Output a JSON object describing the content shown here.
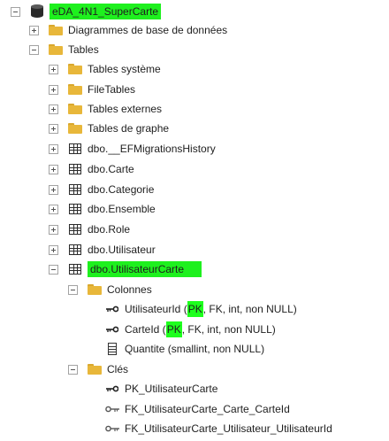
{
  "tree": {
    "root": {
      "label": "eDA_4N1_SuperCarte"
    },
    "diagrams": {
      "label": "Diagrammes de base de données"
    },
    "tables_folder": {
      "label": "Tables"
    },
    "tables_system": {
      "label": "Tables système"
    },
    "filetables": {
      "label": "FileTables"
    },
    "tables_external": {
      "label": "Tables externes"
    },
    "tables_graph": {
      "label": "Tables de graphe"
    },
    "tables": [
      {
        "label": "dbo.__EFMigrationsHistory"
      },
      {
        "label": "dbo.Carte"
      },
      {
        "label": "dbo.Categorie"
      },
      {
        "label": "dbo.Ensemble"
      },
      {
        "label": "dbo.Role"
      },
      {
        "label": "dbo.Utilisateur"
      },
      {
        "label": "dbo.UtilisateurCarte"
      }
    ],
    "columns_folder": {
      "label": "Colonnes"
    },
    "columns": [
      {
        "name": "UtilisateurId (",
        "pk": "PK",
        "rest": ", FK, int, non NULL)"
      },
      {
        "name": "CarteId (",
        "pk": "PK",
        "rest": ", FK, int, non NULL)"
      },
      {
        "name": "Quantite (smallint, non NULL)"
      }
    ],
    "keys_folder": {
      "label": "Clés"
    },
    "keys": [
      {
        "label": "PK_UtilisateurCarte"
      },
      {
        "label": "FK_UtilisateurCarte_Carte_CarteId"
      },
      {
        "label": "FK_UtilisateurCarte_Utilisateur_UtilisateurId"
      }
    ]
  },
  "colors": {
    "highlight": "#1dff1d",
    "folder": "#e8b73a"
  },
  "icons": {
    "database": "database-icon",
    "folder": "folder-icon",
    "table": "table-icon",
    "primary_key": "key-icon",
    "foreign_key": "foreign-key-icon",
    "column": "column-icon"
  }
}
